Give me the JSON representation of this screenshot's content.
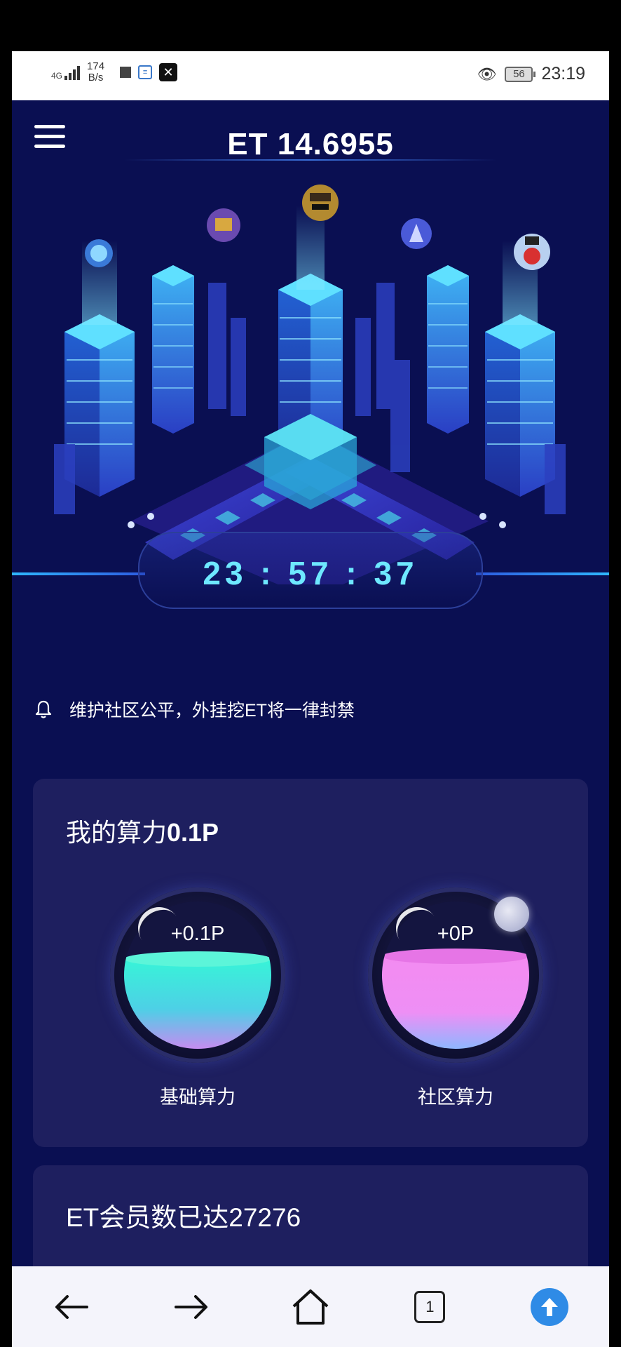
{
  "status_bar": {
    "network": "4G",
    "speed_value": "174",
    "speed_unit": "B/s",
    "battery": "56",
    "time": "23:19"
  },
  "header": {
    "title": "ET 14.6955",
    "menu_icon": "hamburger-icon"
  },
  "timer": {
    "value": "23 : 57 : 37"
  },
  "notice": {
    "icon": "bell-icon",
    "text": "维护社区公平，外挂挖ET将一律封禁"
  },
  "hashpower": {
    "title_prefix": "我的算力",
    "title_value": "0.1P",
    "basic": {
      "value": "+0.1P",
      "label": "基础算力",
      "color": "#38f3d8"
    },
    "community": {
      "value": "+0P",
      "label": "社区算力",
      "color": "#f38bf1"
    }
  },
  "members": {
    "title": "ET会员数已达27276"
  },
  "navbar": {
    "tab_count": "1",
    "icons": [
      "back-arrow-icon",
      "forward-arrow-icon",
      "home-icon",
      "tabs-icon",
      "upload-icon"
    ]
  },
  "colors": {
    "background": "#0a0f52",
    "card": "#1e1f5f",
    "timer_text": "#6ee8ff",
    "nav_accent": "#2f8be6"
  }
}
